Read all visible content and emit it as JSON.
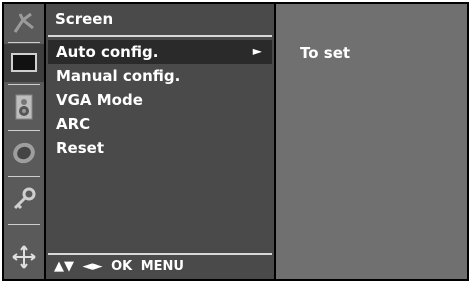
{
  "menu": {
    "title": "Screen",
    "items": [
      {
        "label": "Auto config.",
        "arrow": "►",
        "active": true
      },
      {
        "label": "Manual config.",
        "arrow": ""
      },
      {
        "label": "VGA Mode",
        "arrow": ""
      },
      {
        "label": "ARC",
        "arrow": ""
      },
      {
        "label": "Reset",
        "arrow": ""
      }
    ]
  },
  "nav_hint": {
    "updown": "▲▼",
    "leftright": "◄►",
    "ok": "OK",
    "menu": "MENU"
  },
  "submenu": {
    "text": "To set"
  },
  "icons": [
    "station-icon",
    "screen-icon",
    "speaker-icon",
    "clock-icon",
    "key-icon",
    "cross-arrows-icon"
  ],
  "colors": {
    "panel": "#4a4a4a",
    "highlight": "#2a2a2a",
    "subpanel": "#707070",
    "iconbar": "#5a5a5a"
  }
}
